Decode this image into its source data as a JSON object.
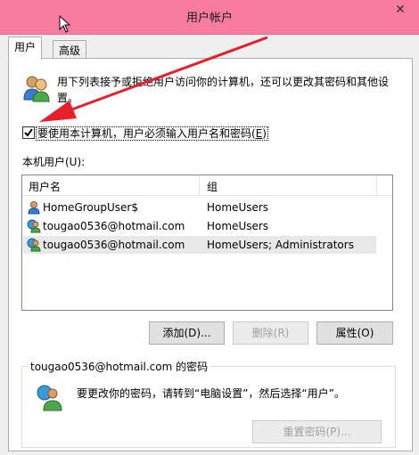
{
  "window": {
    "title": "用户帐户",
    "close_glyph": "✕"
  },
  "tabs": [
    {
      "label": "用户",
      "active": true
    },
    {
      "label": "高级",
      "active": false
    }
  ],
  "intro": {
    "text": "用下列表接予或拒绝用户访问你的计算机，还可以更改其密码和其他设置。"
  },
  "require_login": {
    "label_before": "要使用本计算机，用户必须输入用户名和密码(",
    "label_key": "E",
    "label_after": ")",
    "checked": true
  },
  "users_list": {
    "label": "本机用户(U):",
    "columns": [
      "用户名",
      "组"
    ],
    "rows": [
      {
        "name": "HomeGroupUser$",
        "group": "HomeUsers",
        "icon": "user-icon"
      },
      {
        "name": "tougao0536@hotmail.com",
        "group": "HomeUsers",
        "icon": "microsoft-account-user-icon"
      },
      {
        "name": "tougao0536@hotmail.com",
        "group": "HomeUsers; Administrators",
        "icon": "microsoft-account-user-icon",
        "selected": true
      }
    ]
  },
  "buttons": {
    "add": "添加(D)...",
    "remove": "删除(R)",
    "properties": "属性(O)",
    "reset_password": "重置密码(P)..."
  },
  "password_group": {
    "legend": "tougao0536@hotmail.com 的密码",
    "text": "要更改你的密码，请转到“电脑设置”，然后选择“用户”。"
  },
  "colors": {
    "titlebar": "#f77ca0",
    "annotation_arrow": "#e6202a"
  }
}
